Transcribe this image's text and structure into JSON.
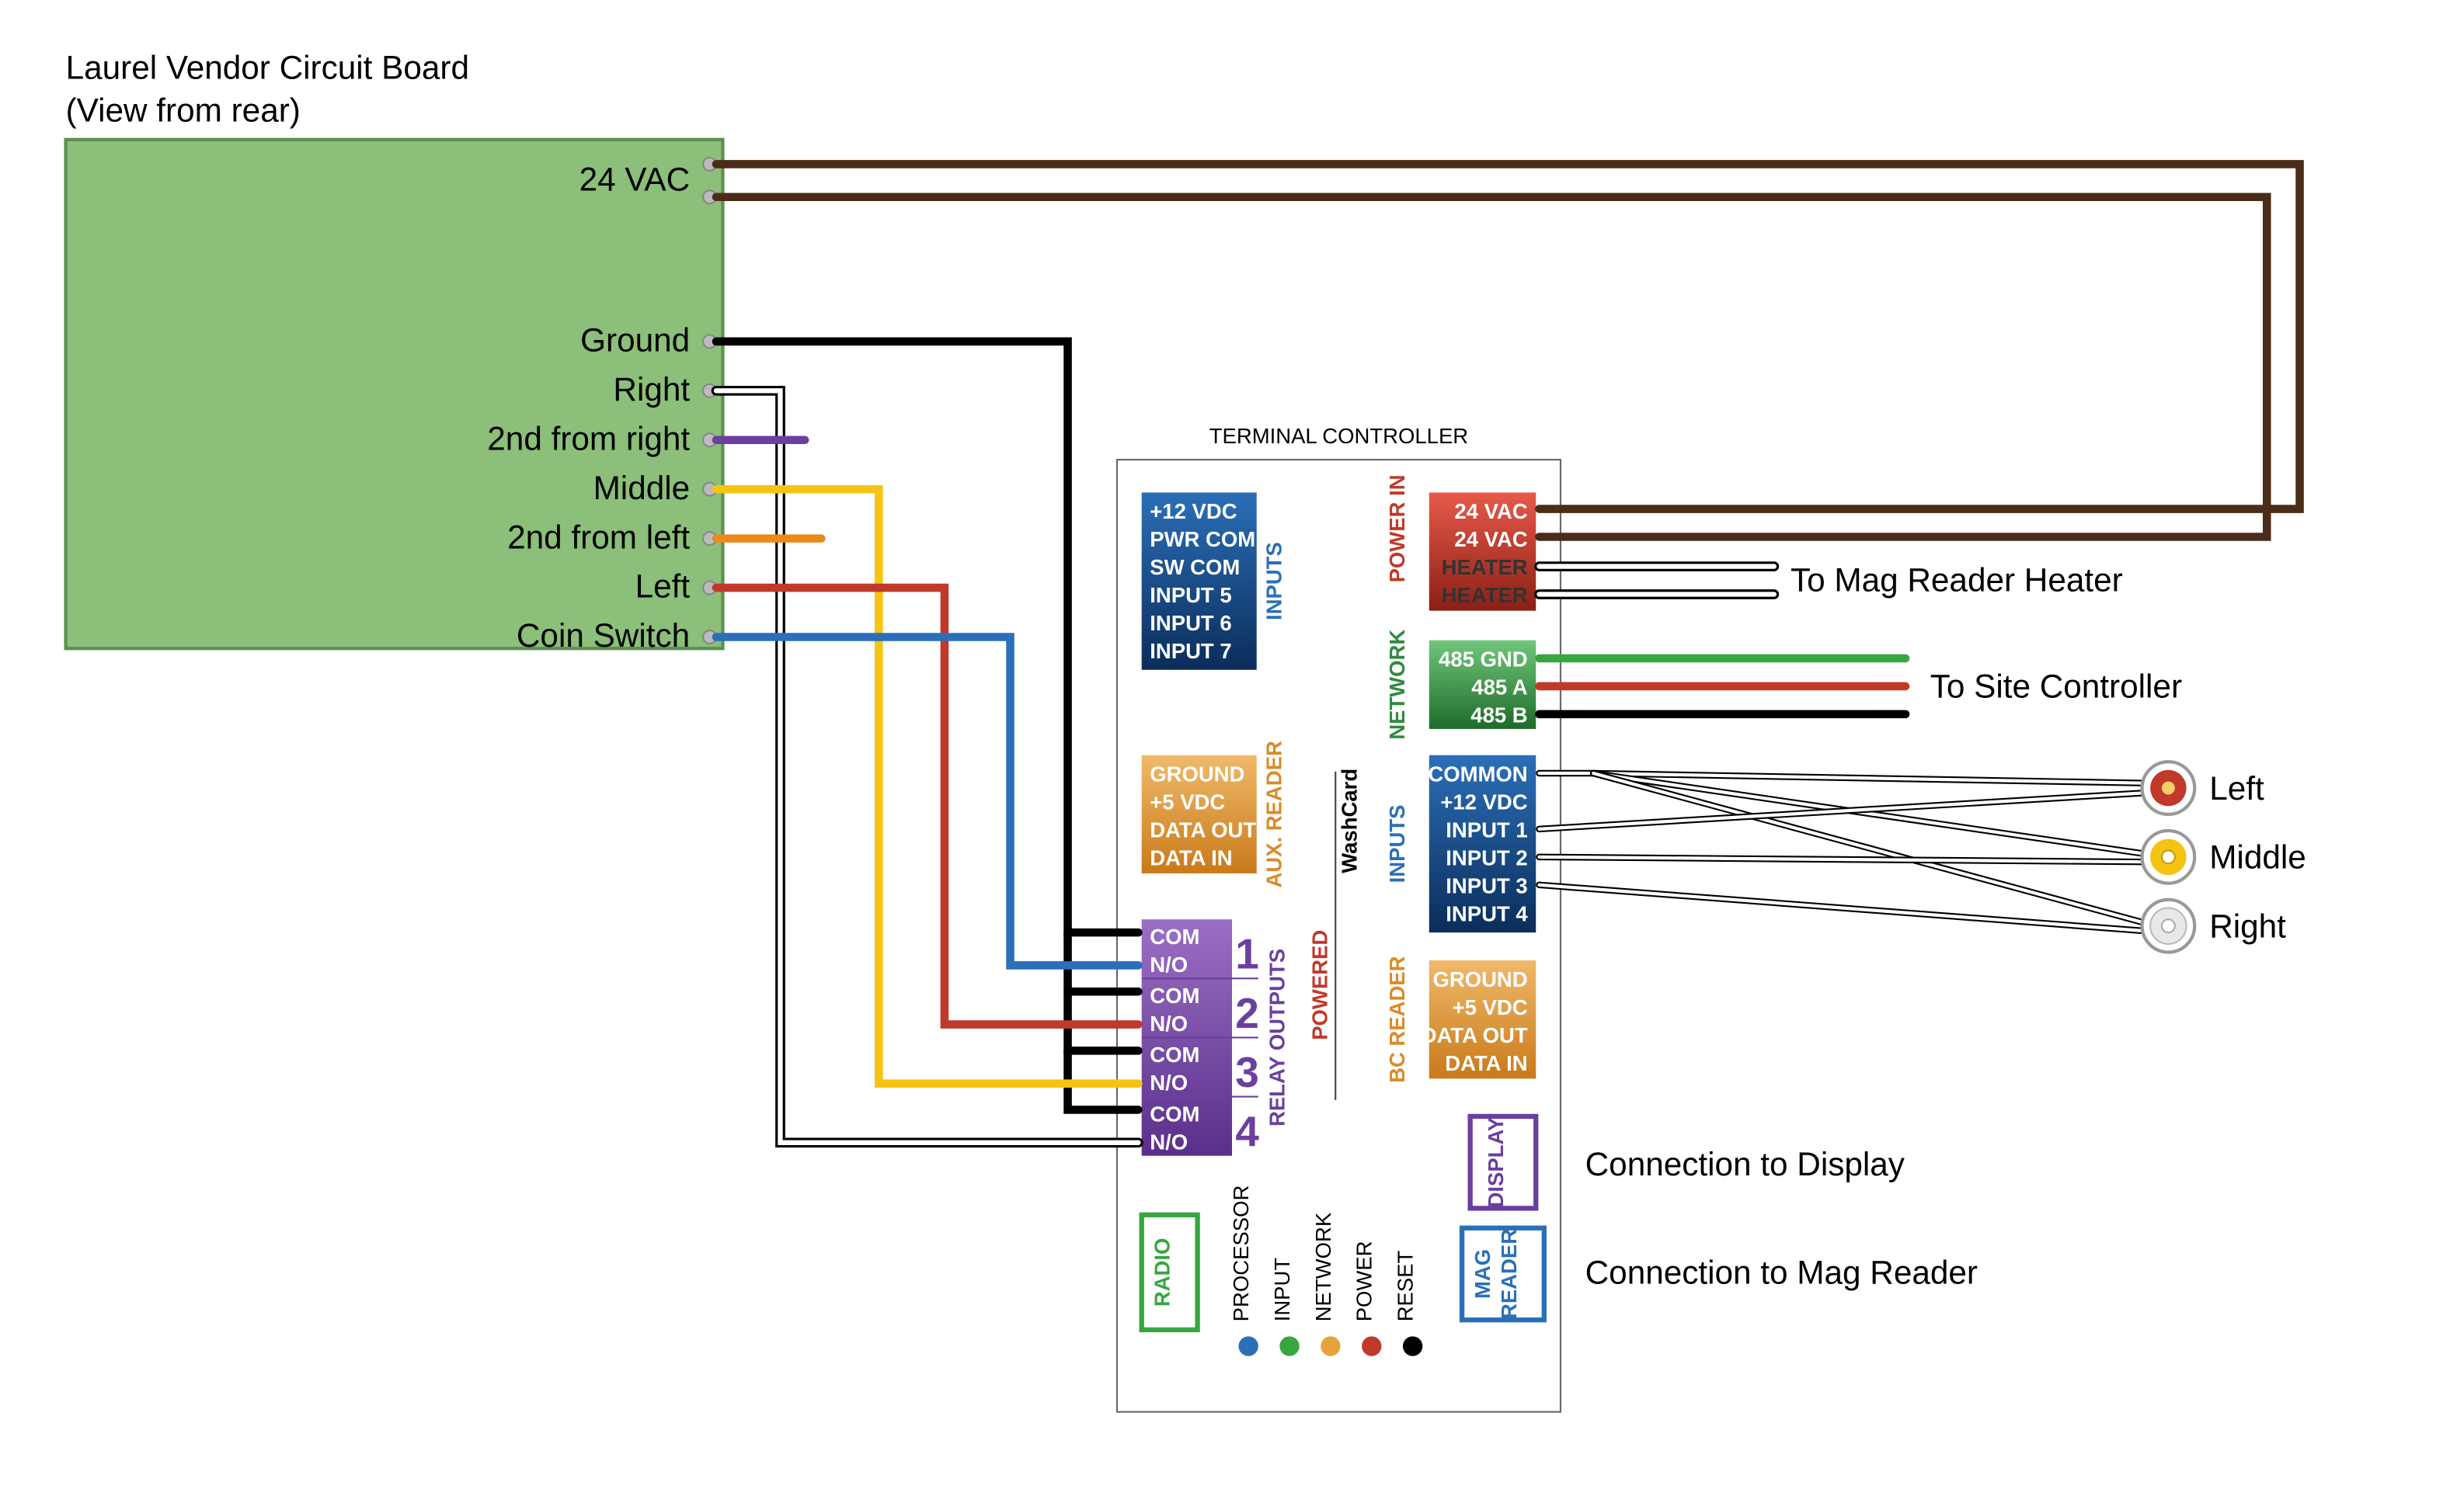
{
  "title": {
    "line1": "Laurel Vendor Circuit Board",
    "line2": "(View from rear)"
  },
  "vendorPins": {
    "vac": "24 VAC",
    "ground": "Ground",
    "right": "Right",
    "second_right": "2nd from right",
    "middle": "Middle",
    "second_left": "2nd from left",
    "left": "Left",
    "coin": "Coin Switch"
  },
  "controller": {
    "title": "TERMINAL CONTROLLER",
    "inputsLeft": [
      "+12 VDC",
      "PWR COM",
      "SW COM",
      "INPUT 5",
      "INPUT 6",
      "INPUT 7"
    ],
    "inputsLeftLabel": "INPUTS",
    "auxReader": [
      "GROUND",
      "+5 VDC",
      "DATA OUT",
      "DATA IN"
    ],
    "auxReaderLabel": "AUX. READER",
    "relayLabel": "RELAY OUTPUTS",
    "relays": [
      {
        "n": "1",
        "a": "COM",
        "b": "N/O"
      },
      {
        "n": "2",
        "a": "COM",
        "b": "N/O"
      },
      {
        "n": "3",
        "a": "COM",
        "b": "N/O"
      },
      {
        "n": "4",
        "a": "COM",
        "b": "N/O"
      }
    ],
    "radioLabel": "RADIO",
    "leds": [
      "PROCESSOR",
      "INPUT",
      "NETWORK",
      "POWER",
      "RESET"
    ],
    "ledColors": [
      "#2b6fb8",
      "#37a640",
      "#e8a23a",
      "#c0392b",
      "#000"
    ],
    "powerInLabel": "POWER IN",
    "powerIn": [
      "24 VAC",
      "24 VAC",
      "HEATER",
      "HEATER"
    ],
    "networkLabel": "NETWORK",
    "network": [
      "485 GND",
      "485 A",
      "485 B"
    ],
    "inputsRightLabel": "INPUTS",
    "inputsRight": [
      "COMMON",
      "+12 VDC",
      "INPUT 1",
      "INPUT 2",
      "INPUT 3",
      "INPUT 4"
    ],
    "bcReaderLabel": "BC READER",
    "bcReader": [
      "GROUND",
      "+5 VDC",
      "DATA OUT",
      "DATA IN"
    ],
    "displayLabel": "DISPLAY",
    "magLabel1": "MAG",
    "magLabel2": "READER",
    "brand1": "POWERED",
    "brand2": "WashCard"
  },
  "external": {
    "heater": "To Mag Reader Heater",
    "site": "To Site Controller",
    "left": "Left",
    "middle": "Middle",
    "right": "Right",
    "display": "Connection to Display",
    "mag": "Connection to Mag Reader"
  },
  "colors": {
    "brown": "#4a2c18",
    "black": "#000",
    "white": "#fff",
    "purple": "#6b3fa0",
    "yellow": "#f5c413",
    "orange": "#e88b1a",
    "red": "#c0392b",
    "blue": "#2b6fb8",
    "green": "#37a640",
    "vendorFill": "#8bbf7a",
    "vendorStroke": "#5a8f4e"
  }
}
